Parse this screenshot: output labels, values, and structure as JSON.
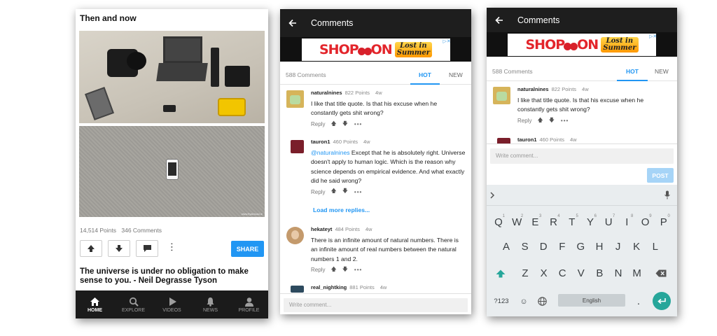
{
  "feed": {
    "post_title": "Then and now",
    "watermark": "www.flyabroad.ie",
    "points": "14,514 Points",
    "comments": "346 Comments",
    "share_label": "SHARE",
    "next_post_title": "The universe is under no obligation to make sense to you. - Neil Degrasse Tyson",
    "nav": [
      {
        "label": "HOME",
        "icon": "home-icon",
        "active": true
      },
      {
        "label": "EXPLORE",
        "icon": "search-icon",
        "active": false
      },
      {
        "label": "VIDEOS",
        "icon": "play-icon",
        "active": false
      },
      {
        "label": "NEWS",
        "icon": "bell-icon",
        "active": false
      },
      {
        "label": "PROFILE",
        "icon": "person-icon",
        "active": false
      }
    ]
  },
  "comments_screen": {
    "title": "Comments",
    "ad": {
      "shop": "SHOP",
      "on": "ON",
      "tagline_1": "Lost in",
      "tagline_2": "Summer"
    },
    "count": "588 Comments",
    "tab_hot": "HOT",
    "tab_new": "NEW",
    "reply_label": "Reply",
    "load_more": "Load more replies...",
    "write_placeholder": "Write comment...",
    "post_label": "POST",
    "comments": [
      {
        "user": "naturalnines",
        "points": "822 Points",
        "age": "4w",
        "mention": "",
        "text": "I like that title quote. Is that his excuse when he constantly gets shit wrong?"
      },
      {
        "user": "tauron1",
        "points": "460 Points",
        "age": "4w",
        "mention": "@naturalnines",
        "text": " Except that he is absolutely right. Universe doesn't apply to human logic. Which is the reason why science depends on empirical evidence. And what exactly did he said wrong?"
      },
      {
        "user": "hekateyt",
        "points": "484 Points",
        "age": "4w",
        "mention": "",
        "text": "There is an infinite amount of natural numbers. There is an infinite amount of real numbers between the natural numbers 1 and 2."
      },
      {
        "user": "real_nightking",
        "points": "881 Points",
        "age": "4w",
        "mention": "",
        "text": ""
      }
    ]
  },
  "keyboard": {
    "row1": [
      {
        "k": "Q",
        "alt": "1"
      },
      {
        "k": "W",
        "alt": "2"
      },
      {
        "k": "E",
        "alt": "3"
      },
      {
        "k": "R",
        "alt": "4"
      },
      {
        "k": "T",
        "alt": "5"
      },
      {
        "k": "Y",
        "alt": "6"
      },
      {
        "k": "U",
        "alt": "7"
      },
      {
        "k": "I",
        "alt": "8"
      },
      {
        "k": "O",
        "alt": "9"
      },
      {
        "k": "P",
        "alt": "0"
      }
    ],
    "row2": [
      "A",
      "S",
      "D",
      "F",
      "G",
      "H",
      "J",
      "K",
      "L"
    ],
    "row3": [
      "Z",
      "X",
      "C",
      "V",
      "B",
      "N",
      "M"
    ],
    "symbols_label": "?123",
    "space_label": "English",
    "period_label": "."
  },
  "colors": {
    "accent": "#2196f3",
    "appbar": "#1e1e1e",
    "nav_bg": "#1b1b1b",
    "enter": "#26a69a",
    "post_disabled": "#a6d4f7"
  }
}
